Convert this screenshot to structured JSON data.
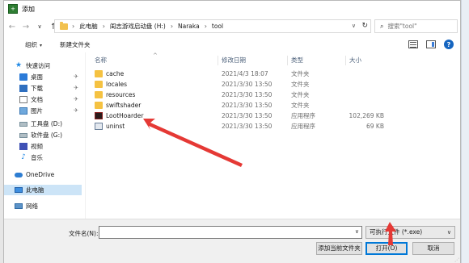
{
  "window": {
    "title": "添加",
    "app_icon_glyph": "+"
  },
  "address": {
    "crumbs": [
      "此电脑",
      "闺志游戏启动盘 (H:)",
      "Naraka",
      "tool"
    ],
    "separator": "›",
    "nav_back": "←",
    "nav_forward": "→",
    "nav_recent": "∨",
    "nav_up": "↑",
    "dropdown": "∨",
    "refresh": "↻"
  },
  "search": {
    "placeholder": "搜索\"tool\"",
    "icon": "⌕"
  },
  "commands": {
    "organize": "组织",
    "caret": "▾",
    "new_folder": "新建文件夹",
    "help": "?"
  },
  "nav": {
    "items": [
      {
        "label": "快速访问",
        "icon": "star-icon",
        "glyph": "★",
        "pinned": false
      },
      {
        "label": "桌面",
        "icon": "desktop-icon",
        "glyph": "",
        "pinned": true
      },
      {
        "label": "下载",
        "icon": "download-icon",
        "glyph": "",
        "pinned": true
      },
      {
        "label": "文档",
        "icon": "document-icon",
        "glyph": "",
        "pinned": true
      },
      {
        "label": "图片",
        "icon": "picture-icon",
        "glyph": "",
        "pinned": true
      },
      {
        "label": "工具盘 (D:)",
        "icon": "drive-icon",
        "glyph": "",
        "pinned": false
      },
      {
        "label": "软件盘 (G:)",
        "icon": "drive-icon",
        "glyph": "",
        "pinned": false
      },
      {
        "label": "视频",
        "icon": "video-icon",
        "glyph": "",
        "pinned": false
      },
      {
        "label": "音乐",
        "icon": "music-icon",
        "glyph": "♪",
        "pinned": false
      },
      {
        "label": "OneDrive",
        "icon": "cloud-icon",
        "glyph": "",
        "pinned": false
      },
      {
        "label": "此电脑",
        "icon": "computer-icon",
        "glyph": "",
        "pinned": false,
        "selected": true
      },
      {
        "label": "网络",
        "icon": "network-icon",
        "glyph": "",
        "pinned": false
      }
    ],
    "pin_glyph": "✈"
  },
  "columns": {
    "name": "名称",
    "date": "修改日期",
    "type": "类型",
    "size": "大小",
    "sort_glyph": "^"
  },
  "files": [
    {
      "name": "cache",
      "date": "2021/4/3 18:07",
      "type": "文件夹",
      "size": "",
      "icon": "folder-icon"
    },
    {
      "name": "locales",
      "date": "2021/3/30 13:50",
      "type": "文件夹",
      "size": "",
      "icon": "folder-icon"
    },
    {
      "name": "resources",
      "date": "2021/3/30 13:50",
      "type": "文件夹",
      "size": "",
      "icon": "folder-icon"
    },
    {
      "name": "swiftshader",
      "date": "2021/3/30 13:50",
      "type": "文件夹",
      "size": "",
      "icon": "folder-icon"
    },
    {
      "name": "LootHoarder",
      "date": "2021/3/30 13:50",
      "type": "应用程序",
      "size": "102,269 KB",
      "icon": "app-icon"
    },
    {
      "name": "uninst",
      "date": "2021/3/30 13:50",
      "type": "应用程序",
      "size": "69 KB",
      "icon": "setup-icon"
    }
  ],
  "bottom": {
    "filename_label": "文件名(N):",
    "filename_value": "",
    "filename_drop": "∨",
    "filter": "可执行文件 (*.exe)",
    "filter_drop": "∨",
    "add_current": "添加当前文件夹",
    "open": "打开(O)",
    "cancel": "取消",
    "grip": "⋰"
  },
  "annotations": {
    "arrow_color": "#e53935"
  }
}
